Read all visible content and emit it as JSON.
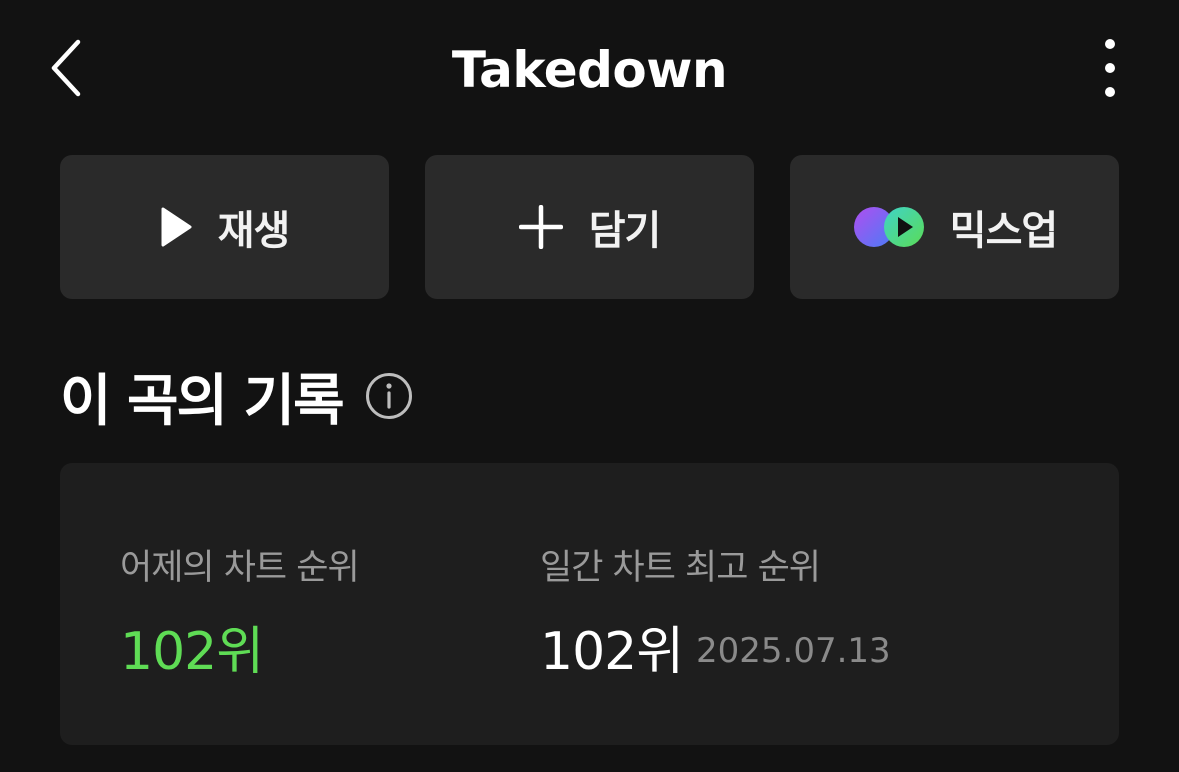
{
  "header": {
    "title": "Takedown",
    "back_icon": "chevron-left-icon",
    "more_icon": "more-vertical-icon"
  },
  "actions": [
    {
      "label": "재생",
      "icon": "play-icon"
    },
    {
      "label": "담기",
      "icon": "plus-icon"
    },
    {
      "label": "믹스업",
      "icon": "mixup-icon"
    }
  ],
  "record": {
    "title": "이 곡의 기록",
    "info_icon": "info-icon",
    "yesterday": {
      "label": "어제의 차트 순위",
      "value": "102위"
    },
    "best": {
      "label": "일간 차트 최고 순위",
      "value": "102위",
      "date": "2025.07.13"
    }
  },
  "colors": {
    "background": "#121212",
    "button": "#2a2a2a",
    "card": "#1e1e1e",
    "accent_green": "#5fdc55"
  }
}
